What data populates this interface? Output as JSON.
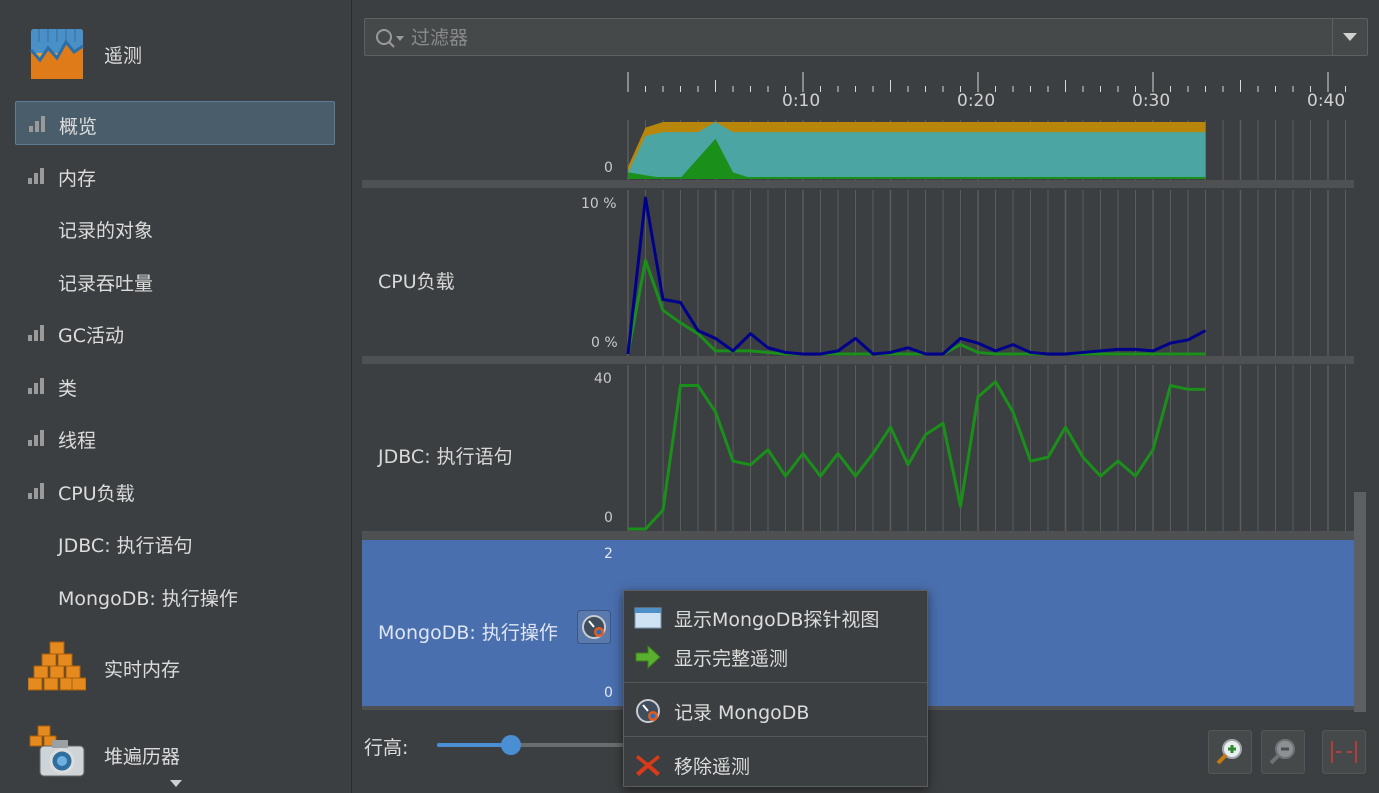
{
  "sidebar": {
    "header_telemetry": "遥测",
    "items": [
      {
        "label": "概览",
        "bars": true,
        "selected": true
      },
      {
        "label": "内存",
        "bars": true
      },
      {
        "label": "记录的对象",
        "bars": false
      },
      {
        "label": "记录吞吐量",
        "bars": false
      },
      {
        "label": "GC活动",
        "bars": true
      },
      {
        "label": "类",
        "bars": true
      },
      {
        "label": "线程",
        "bars": true
      },
      {
        "label": "CPU负载",
        "bars": true
      },
      {
        "label": "JDBC: 执行语句",
        "bars": false
      },
      {
        "label": "MongoDB: 执行操作",
        "bars": false
      }
    ],
    "header_live_memory": "实时内存",
    "header_heap_walker": "堆遍历器"
  },
  "filter": {
    "placeholder": "过滤器"
  },
  "timeline": {
    "ticks": [
      "0:10",
      "0:20",
      "0:30",
      "0:40"
    ]
  },
  "rows": {
    "memory": {
      "label": "",
      "ymin": "0"
    },
    "cpu": {
      "label": "CPU负载",
      "ymax": "10 %",
      "ymin": "0 %"
    },
    "jdbc": {
      "label": "JDBC: 执行语句",
      "ymax": "40",
      "ymin": "0"
    },
    "mongo": {
      "label": "MongoDB: 执行操作",
      "ymax": "2",
      "ymin": "0"
    }
  },
  "bottom": {
    "row_height_label": "行高:",
    "row_height_value": 0.37
  },
  "context_menu": {
    "show_probe_view": "显示MongoDB探针视图",
    "show_full_telemetry": "显示完整遥测",
    "record_mongodb": "记录 MongoDB",
    "remove_telemetry": "移除遥测"
  },
  "colors": {
    "selection": "#4a6fae",
    "accent": "#4a8ed3",
    "cpu_line": "#00008b",
    "green_line": "#1a8f1a",
    "memory_teal": "#4ba5a2",
    "memory_gold": "#b8860b"
  },
  "chart_data": [
    {
      "type": "area",
      "title": "",
      "x": [
        0,
        1,
        2,
        3,
        4,
        5,
        6,
        7,
        8,
        9,
        10,
        11,
        12,
        13,
        14,
        15,
        16,
        17,
        18,
        19,
        20,
        21,
        22,
        23,
        24,
        25,
        26,
        27,
        28,
        29,
        30,
        31,
        32,
        33
      ],
      "series": [
        {
          "name": "",
          "values": [
            0.2,
            0.9,
            1,
            1,
            1,
            1,
            1,
            1,
            1,
            1,
            1,
            1,
            1,
            1,
            1,
            1,
            1,
            1,
            1,
            1,
            1,
            1,
            1,
            1,
            1,
            1,
            1,
            1,
            1,
            1,
            1,
            1,
            1,
            1
          ]
        },
        {
          "name": "",
          "values": [
            0.1,
            0.75,
            0.82,
            0.82,
            0.82,
            1,
            0.82,
            0.82,
            0.82,
            0.82,
            0.82,
            0.82,
            0.82,
            0.82,
            0.82,
            0.82,
            0.82,
            0.82,
            0.82,
            0.82,
            0.82,
            0.82,
            0.82,
            0.82,
            0.82,
            0.82,
            0.82,
            0.82,
            0.82,
            0.82,
            0.82,
            0.82,
            0.82,
            0.82
          ]
        },
        {
          "name": "",
          "values": [
            0.1,
            0.05,
            0,
            0,
            0.35,
            0.7,
            0.1,
            0,
            0,
            0,
            0,
            0,
            0,
            0,
            0,
            0,
            0,
            0,
            0,
            0,
            0,
            0,
            0,
            0,
            0,
            0,
            0,
            0,
            0,
            0,
            0,
            0,
            0,
            0
          ]
        }
      ]
    },
    {
      "type": "line",
      "title": "CPU负载",
      "ylim": [
        0,
        10
      ],
      "x": [
        0,
        1,
        2,
        3,
        4,
        5,
        6,
        7,
        8,
        9,
        10,
        11,
        12,
        13,
        14,
        15,
        16,
        17,
        18,
        19,
        20,
        21,
        22,
        23,
        24,
        25,
        26,
        27,
        28,
        29,
        30,
        31,
        32,
        33
      ],
      "series": [
        {
          "name": "",
          "color": "#00008b",
          "values": [
            0,
            10,
            3.5,
            3.3,
            1.5,
            1.0,
            0.2,
            1.3,
            0.4,
            0.1,
            0,
            0,
            0.2,
            1.0,
            0,
            0.1,
            0.4,
            0,
            0,
            1.0,
            0.7,
            0.2,
            0.6,
            0.1,
            0,
            0,
            0.1,
            0.2,
            0.3,
            0.3,
            0.2,
            0.7,
            0.9,
            1.5
          ]
        },
        {
          "name": "",
          "color": "#1a8f1a",
          "values": [
            0,
            6,
            2.8,
            2,
            1.3,
            0.2,
            0.2,
            0.2,
            0.1,
            0,
            0,
            0,
            0,
            0,
            0,
            0,
            0,
            0,
            0,
            0.6,
            0.1,
            0,
            0,
            0,
            0,
            0,
            0,
            0,
            0,
            0,
            0,
            0,
            0,
            0
          ]
        }
      ]
    },
    {
      "type": "line",
      "title": "JDBC: 执行语句",
      "ylim": [
        0,
        40
      ],
      "x": [
        0,
        1,
        2,
        3,
        4,
        5,
        6,
        7,
        8,
        9,
        10,
        11,
        12,
        13,
        14,
        15,
        16,
        17,
        18,
        19,
        20,
        21,
        22,
        23,
        24,
        25,
        26,
        27,
        28,
        29,
        30,
        31,
        32,
        33
      ],
      "series": [
        {
          "name": "",
          "color": "#1a8f1a",
          "values": [
            0,
            0,
            5,
            38,
            38,
            31,
            18,
            17,
            21,
            14,
            20,
            14,
            20,
            14,
            20,
            27,
            17,
            25,
            28,
            6,
            35,
            39,
            31,
            18,
            19,
            27,
            19,
            14,
            18,
            14,
            21,
            38,
            37,
            37
          ]
        }
      ]
    },
    {
      "type": "line",
      "title": "MongoDB: 执行操作",
      "ylim": [
        0,
        2
      ],
      "x": [],
      "series": []
    }
  ]
}
